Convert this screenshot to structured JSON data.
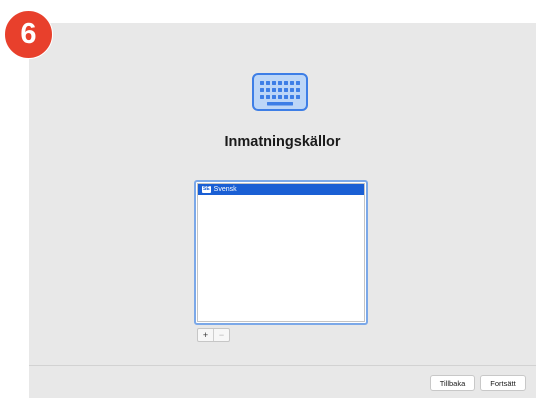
{
  "step_badge": "6",
  "header": {
    "icon": "keyboard-icon",
    "title": "Inmatningskällor"
  },
  "input_sources": {
    "items": [
      {
        "flag": "SE",
        "label": "Svensk",
        "selected": true
      }
    ]
  },
  "list_controls": {
    "add": "+",
    "remove": "−"
  },
  "footer": {
    "back_label": "Tillbaka",
    "continue_label": "Fortsätt"
  },
  "colors": {
    "accent": "#1a5fd4",
    "badge": "#e8402c",
    "background": "#e8e8e8"
  }
}
